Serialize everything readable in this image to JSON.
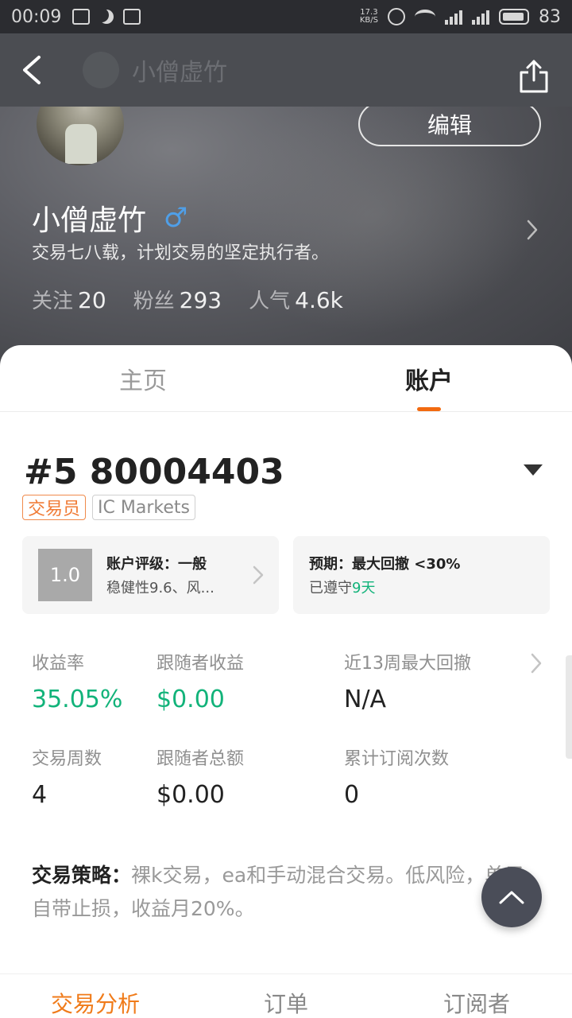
{
  "status_bar": {
    "time": "00:09",
    "net_speed": "17.3\nKB/S",
    "battery": "83"
  },
  "nav": {
    "title": "小僧虚竹"
  },
  "profile": {
    "edit_label": "编辑",
    "name": "小僧虚竹",
    "gender_symbol": "♂",
    "bio": "交易七八载，计划交易的坚定执行者。",
    "stats": [
      {
        "label": "关注",
        "value": "20"
      },
      {
        "label": "粉丝",
        "value": "293"
      },
      {
        "label": "人气",
        "value": "4.6k"
      }
    ]
  },
  "tabs": [
    {
      "label": "主页",
      "active": false
    },
    {
      "label": "账户",
      "active": true
    }
  ],
  "account": {
    "number": "#5 80004403",
    "tags": [
      "交易员",
      "IC Markets"
    ],
    "rating_score": "1.0",
    "rating_title": "账户评级：一般",
    "rating_sub": "稳健性9.6、风...",
    "expect_title": "预期：最大回撤 <30%",
    "expect_sub_prefix": "已遵守",
    "expect_sub_days": "9天"
  },
  "metrics": [
    {
      "label": "收益率",
      "value": "35.05%"
    },
    {
      "label": "跟随者收益",
      "value": "$0.00"
    },
    {
      "label": "近13周最大回撤",
      "value": "N/A"
    },
    {
      "label": "交易周数",
      "value": "4"
    },
    {
      "label": "跟随者总额",
      "value": "$0.00"
    },
    {
      "label": "累计订阅次数",
      "value": "0"
    }
  ],
  "strategy": {
    "label": "交易策略：",
    "text": "裸k交易，ea和手动混合交易。低风险，单子自带止损，收益月20%。"
  },
  "bottom_tabs": [
    {
      "label": "交易分析",
      "active": true
    },
    {
      "label": "订单",
      "active": false
    },
    {
      "label": "订阅者",
      "active": false
    }
  ],
  "colors": {
    "accent_orange": "#f26a10",
    "positive_green": "#12b37a"
  },
  "icons": [
    "back-arrow-icon",
    "share-icon",
    "male-icon",
    "chevron-right-icon",
    "dropdown-arrow-icon",
    "chevron-up-icon"
  ]
}
